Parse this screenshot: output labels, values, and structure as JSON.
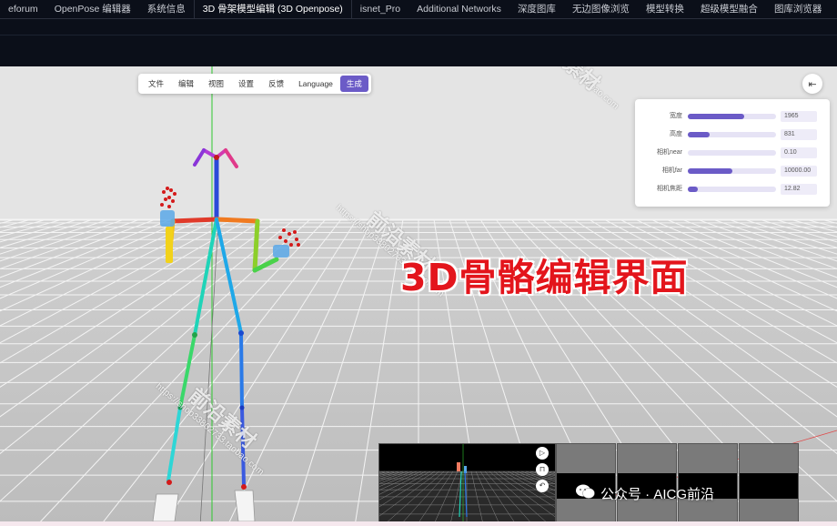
{
  "tabs": [
    {
      "label": "eforum",
      "active": false
    },
    {
      "label": "OpenPose 编辑器",
      "active": false
    },
    {
      "label": "系统信息",
      "active": false
    },
    {
      "label": "3D 骨架模型编辑 (3D Openpose)",
      "active": true
    },
    {
      "label": "isnet_Pro",
      "active": false
    },
    {
      "label": "Additional Networks",
      "active": false
    },
    {
      "label": "深度图库",
      "active": false
    },
    {
      "label": "无边图像浏览",
      "active": false
    },
    {
      "label": "模型转换",
      "active": false
    },
    {
      "label": "超级模型融合",
      "active": false
    },
    {
      "label": "图库浏览器",
      "active": false
    }
  ],
  "menu": {
    "items": [
      "文件",
      "编辑",
      "视图",
      "设置",
      "反馈",
      "Language"
    ],
    "generate_label": "生成"
  },
  "collapse_icon": "arrow-left-bar-icon",
  "params": [
    {
      "label": "宽度",
      "value": "1965",
      "fraction": 0.64
    },
    {
      "label": "高度",
      "value": "831",
      "fraction": 0.25
    },
    {
      "label": "相机near",
      "value": "0.10",
      "fraction": 0.0
    },
    {
      "label": "相机far",
      "value": "10000.00",
      "fraction": 0.5
    },
    {
      "label": "相机焦距",
      "value": "12.82",
      "fraction": 0.11
    }
  ],
  "caption": "3D骨骼编辑界面",
  "watermark": {
    "url": "https://shop33802733.taobao.com",
    "brand": "前沿素材"
  },
  "footer": {
    "text": "公众号 · AICG前沿",
    "icon": "wechat-icon"
  },
  "preview_tools": [
    "play-icon",
    "lock-icon",
    "undo-icon"
  ],
  "colors": {
    "accent": "#6b5bc7",
    "caption": "#e3151c",
    "background": "#0b0f19"
  }
}
